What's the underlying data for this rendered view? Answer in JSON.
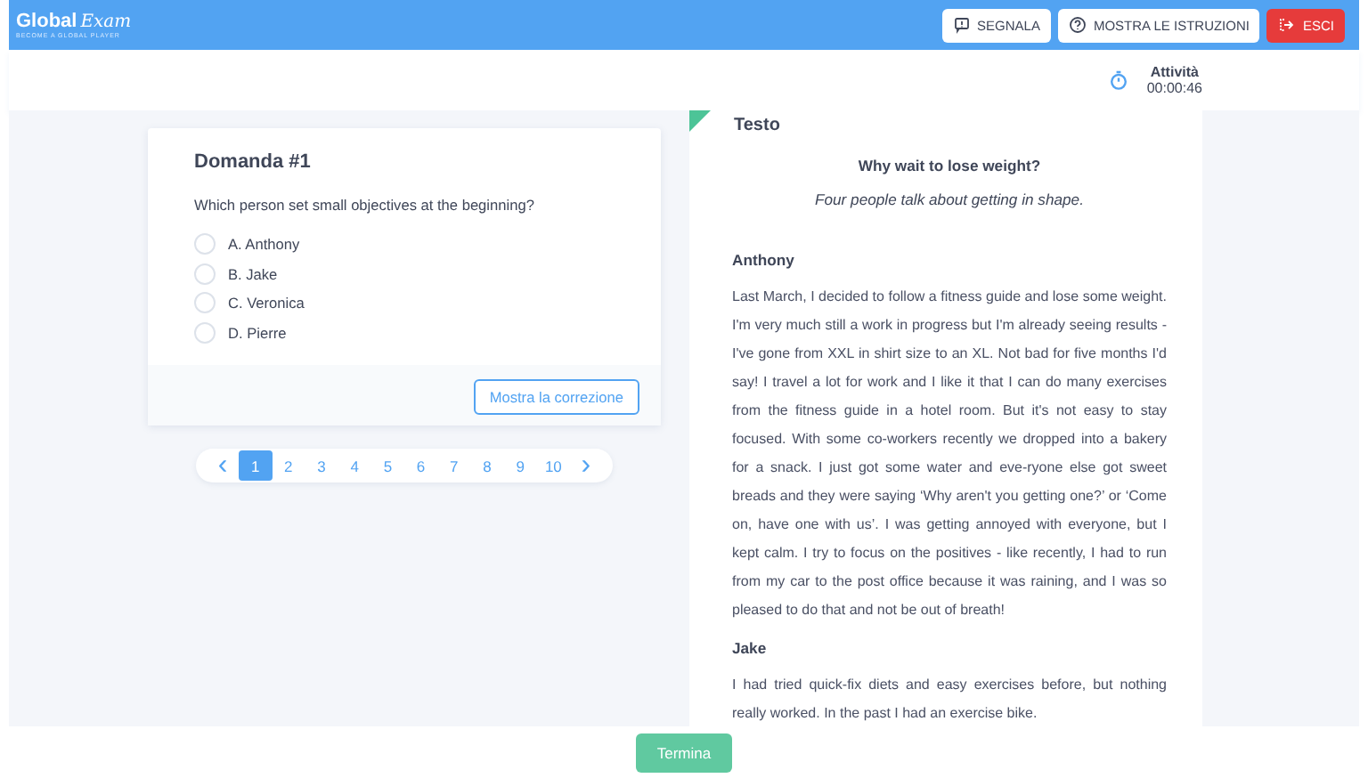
{
  "header": {
    "logo": {
      "main": "Global",
      "script": "Exam",
      "tagline": "BECOME A GLOBAL PLAYER"
    },
    "buttons": [
      {
        "kind": "report",
        "label": "SEGNALA"
      },
      {
        "kind": "help",
        "label": "MOSTRA LE ISTRUZIONI"
      },
      {
        "kind": "exit",
        "label": "ESCI"
      }
    ]
  },
  "timer": {
    "label": "Attività",
    "time": "00:00:46"
  },
  "question": {
    "title": "Domanda #1",
    "text": "Which person set small objectives at the beginning?",
    "options": [
      {
        "label": "A. Anthony",
        "selected": false
      },
      {
        "label": "B. Jake",
        "selected": false
      },
      {
        "label": "C. Veronica",
        "selected": false
      },
      {
        "label": "D. Pierre",
        "selected": false
      }
    ],
    "correction_button": "Mostra la correzione"
  },
  "pagination": {
    "prev": "‹",
    "next": "›",
    "pages": [
      {
        "label": "1",
        "selected": true
      },
      {
        "label": "2",
        "selected": false
      },
      {
        "label": "3",
        "selected": false
      },
      {
        "label": "4",
        "selected": false
      },
      {
        "label": "5",
        "selected": false
      },
      {
        "label": "6",
        "selected": false
      },
      {
        "label": "7",
        "selected": false
      },
      {
        "label": "8",
        "selected": false
      },
      {
        "label": "9",
        "selected": false
      },
      {
        "label": "10",
        "selected": false
      }
    ]
  },
  "text_panel": {
    "heading": "Testo",
    "title": "Why wait to lose weight?",
    "subtitle": "Four people talk about getting in shape.",
    "sections": [
      {
        "name": "Anthony",
        "body": "Last March, I decided to follow a fitness guide and lose some weight. I'm very much still a work in progress but I'm already seeing results - I've gone from XXL in shirt size to an XL. Not bad for five months I'd say! I travel a lot for work and I like it that I can do many exercises from the fitness guide in a hotel room. But it's not easy to stay focused. With some co-workers recently we dropped into a bakery for a snack. I just got some water and eve-ryone else got sweet breads and they were saying ‘Why aren't you getting one?’ or ‘Come on, have one with us’. I was getting annoyed with everyone, but I kept calm. I try to focus on the positives - like recently, I had to run from my car to the post office because it was raining, and I was so pleased to do that and not be out of breath!"
      },
      {
        "name": "Jake",
        "body": "I had tried quick-fix diets and easy exercises before, but nothing really worked. In the past I had an exercise bike."
      }
    ]
  },
  "footer": {
    "finish_button": "Termina"
  }
}
